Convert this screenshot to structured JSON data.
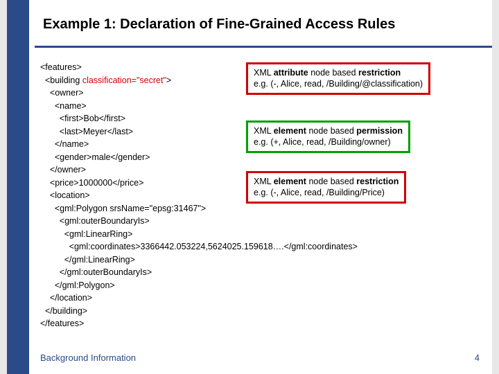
{
  "title": "Example 1: Declaration of Fine-Grained Access Rules",
  "code": {
    "l1": "<features>",
    "l2a": "  <building ",
    "l2b": "classification=\"secret\"",
    "l2c": ">",
    "l3": "    <owner>",
    "l4": "      <name>",
    "l5": "        <first>Bob</first>",
    "l6": "        <last>Meyer</last>",
    "l7": "      </name>",
    "l8": "      <gender>male</gender>",
    "l9": "    </owner>",
    "l10": "    <price>1000000</price>",
    "l11": "    <location>",
    "l12": "      <gml:Polygon srsName=\"epsg:31467\">",
    "l13": "        <gml:outerBoundaryIs>",
    "l14": "          <gml:LinearRing>",
    "l15": "            <gml:coordinates>3366442.053224,5624025.159618….</gml:coordinates>",
    "l16": "          </gml:LinearRing>",
    "l17": "        </gml:outerBoundaryIs>",
    "l18": "      </gml:Polygon>",
    "l19": "    </location>",
    "l20": "  </building>",
    "l21": "</features>"
  },
  "callouts": {
    "c1": {
      "line1_a": "XML ",
      "line1_b": "attribute",
      "line1_c": " node based ",
      "line1_d": "restriction",
      "line2": "e.g. (-, Alice, read, /Building/@classification)"
    },
    "c2": {
      "line1_a": "XML ",
      "line1_b": "element",
      "line1_c": " node based ",
      "line1_d": "permission",
      "line2": "e.g. (+, Alice, read, /Building/owner)"
    },
    "c3": {
      "line1_a": "XML ",
      "line1_b": "element",
      "line1_c": " node based ",
      "line1_d": "restriction",
      "line2": "e.g. (-, Alice, read, /Building/Price)"
    }
  },
  "footer": {
    "left": "Background Information",
    "right": "4"
  }
}
